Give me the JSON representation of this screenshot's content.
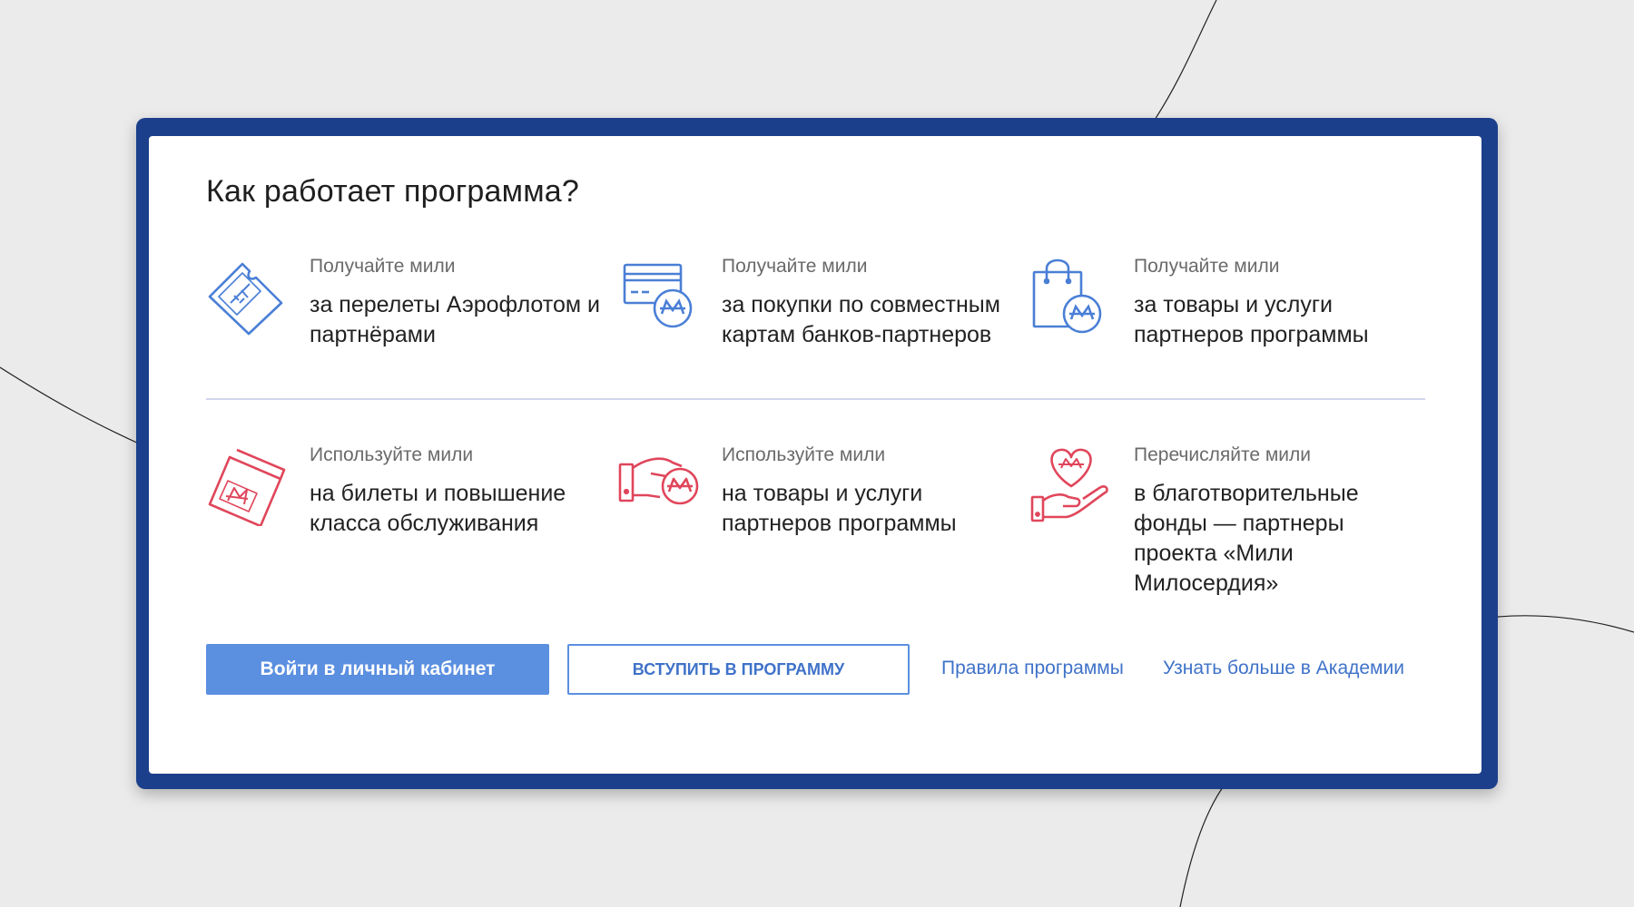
{
  "title": "Как работает программа?",
  "colors": {
    "frame": "#1b3f8b",
    "earn_icon": "#4a7fd6",
    "spend_icon": "#e0465b",
    "primary": "#5b8fe0"
  },
  "earn": [
    {
      "icon": "ticket-plane-icon",
      "label": "Получайте мили",
      "desc": "за перелеты Аэрофлотом и партнёрами"
    },
    {
      "icon": "bank-card-miles-icon",
      "label": "Получайте мили",
      "desc": "за покупки по совместным картам банков-партнеров"
    },
    {
      "icon": "shopping-bag-miles-icon",
      "label": "Получайте мили",
      "desc": "за товары и услуги партнеров программы"
    }
  ],
  "spend": [
    {
      "icon": "tickets-miles-icon",
      "label": "Используйте мили",
      "desc": "на билеты и повышение класса обслуживания"
    },
    {
      "icon": "hand-coin-miles-icon",
      "label": "Используйте мили",
      "desc": "на товары и услуги партнеров программы"
    },
    {
      "icon": "hand-heart-miles-icon",
      "label": "Перечисляйте мили",
      "desc": "в благотворительные фонды — партнеры проекта «Мили Милосердия»"
    }
  ],
  "actions": {
    "login_label": "Войти в личный кабинет",
    "join_label": "Вступить в программу",
    "rules_link": "Правила программы",
    "academy_link": "Узнать больше в Академии"
  }
}
